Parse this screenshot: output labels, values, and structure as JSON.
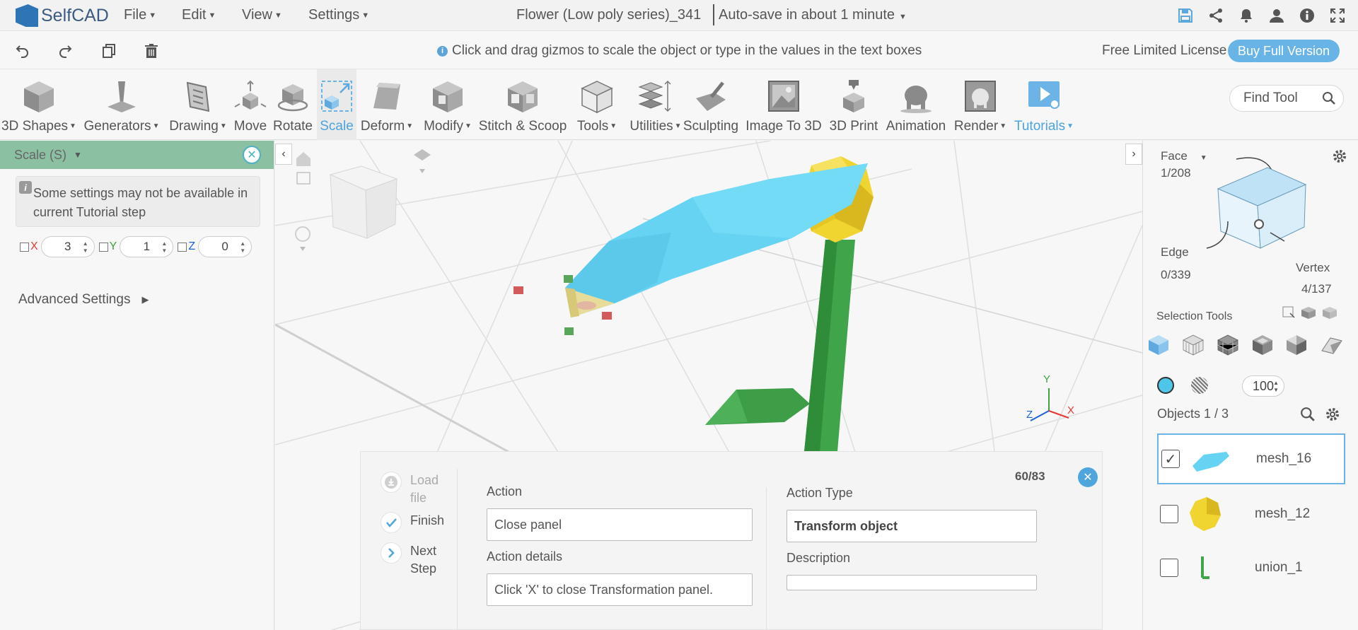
{
  "app": {
    "name": "SelfCAD"
  },
  "menus": [
    "File",
    "Edit",
    "View",
    "Settings"
  ],
  "document": {
    "title": "Flower (Low poly series)_341",
    "autosave": "Auto-save in about 1 minute"
  },
  "hint": "Click and drag gizmos to scale the object or type in the values in the text boxes",
  "license": {
    "text": "Free Limited License",
    "buy_label": "Buy Full Version"
  },
  "toolbar": {
    "tools": [
      {
        "label": "3D Shapes",
        "has_menu": true
      },
      {
        "label": "Generators",
        "has_menu": true
      },
      {
        "label": "Drawing",
        "has_menu": true
      },
      {
        "label": "Move",
        "has_menu": false
      },
      {
        "label": "Rotate",
        "has_menu": false
      },
      {
        "label": "Scale",
        "has_menu": false,
        "active": true
      },
      {
        "label": "Deform",
        "has_menu": true
      },
      {
        "label": "Modify",
        "has_menu": true
      },
      {
        "label": "Stitch & Scoop",
        "has_menu": false
      },
      {
        "label": "Tools",
        "has_menu": true
      },
      {
        "label": "Utilities",
        "has_menu": true
      },
      {
        "label": "Sculpting",
        "has_menu": false
      },
      {
        "label": "Image To 3D",
        "has_menu": false
      },
      {
        "label": "3D Print",
        "has_menu": false
      },
      {
        "label": "Animation",
        "has_menu": false
      },
      {
        "label": "Render",
        "has_menu": true
      },
      {
        "label": "Tutorials",
        "has_menu": true
      }
    ],
    "find_tool_placeholder": "Find Tool"
  },
  "left_panel": {
    "title": "Scale (S)",
    "note": "Some settings may not be available in current Tutorial step",
    "axes": [
      {
        "label": "X",
        "value": "3",
        "color": "#e53935"
      },
      {
        "label": "Y",
        "value": "1",
        "color": "#43a047"
      },
      {
        "label": "Z",
        "value": "0",
        "color": "#1e63d6"
      }
    ],
    "advanced_label": "Advanced Settings"
  },
  "tutorial": {
    "steps": [
      {
        "label": "Load file",
        "state": "disabled"
      },
      {
        "label": "Finish",
        "state": "done"
      },
      {
        "label": "Next Step",
        "state": "next"
      }
    ],
    "action_label": "Action",
    "action_value": "Close panel",
    "action_details_label": "Action details",
    "action_details_value": "Click 'X' to close Transformation panel.",
    "action_type_label": "Action Type",
    "action_type_value": "Transform object",
    "description_label": "Description",
    "description_value": "",
    "progress": "60/83"
  },
  "right_panel": {
    "face_label": "Face",
    "face_count": "1/208",
    "edge_label": "Edge",
    "edge_count": "0/339",
    "vertex_label": "Vertex",
    "vertex_count": "4/137",
    "selection_tools_label": "Selection Tools",
    "brush_size": "100",
    "objects_label": "Objects 1 / 3",
    "objects": [
      {
        "name": "mesh_16",
        "checked": true,
        "selected": true
      },
      {
        "name": "mesh_12",
        "checked": false,
        "selected": false
      },
      {
        "name": "union_1",
        "checked": false,
        "selected": false
      }
    ]
  },
  "gizmo_axes": {
    "x": "X",
    "y": "Y",
    "z": "Z"
  },
  "colors": {
    "accent": "#4ca3dd",
    "panel_header": "#8cc0a3",
    "petal": "#66d3f2",
    "center": "#f0d430",
    "stem": "#3fa44a"
  }
}
